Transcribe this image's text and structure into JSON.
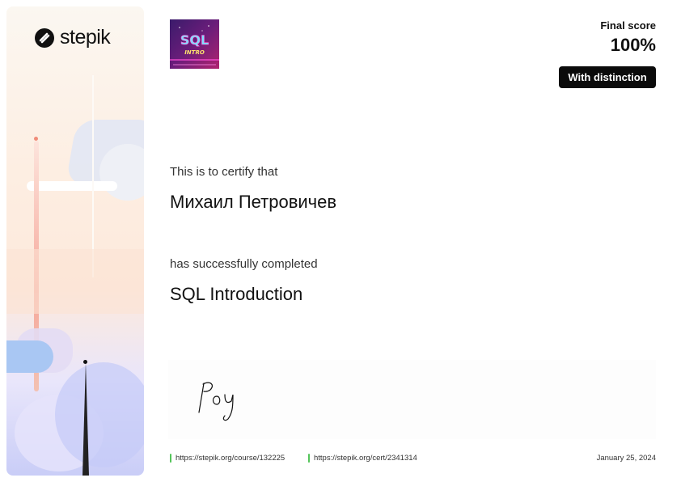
{
  "brand": {
    "name": "stepik"
  },
  "course_badge": {
    "text": "SQL",
    "subtext": "INTRO"
  },
  "score": {
    "label": "Final score",
    "value": "100%",
    "badge": "With distinction"
  },
  "certificate": {
    "intro": "This is to certify that",
    "recipient": "Михаил Петровичев",
    "completion_text": "has successfully completed",
    "course_name": "SQL Introduction"
  },
  "signature": {
    "text": "Poy"
  },
  "footer": {
    "course_link": "https://stepik.org/course/132225",
    "cert_link": "https://stepik.org/cert/2341314",
    "date": "January 25, 2024"
  },
  "colors": {
    "link_accent": "#54c55a",
    "badge_bg": "#0b0b0b",
    "text": "#111111"
  }
}
